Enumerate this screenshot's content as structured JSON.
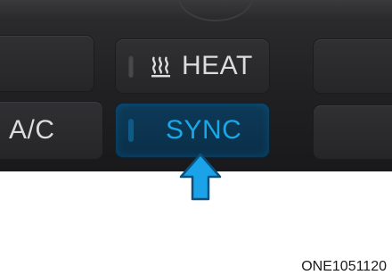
{
  "panel": {
    "heat_label": "HEAT",
    "heat_icon": "seat-heat-icon",
    "ac_label": "A/C",
    "sync_label": "SYNC",
    "sync_color": "#19a7e6",
    "arrow_color": "#1aa3e8"
  },
  "caption": "ONE1051120"
}
